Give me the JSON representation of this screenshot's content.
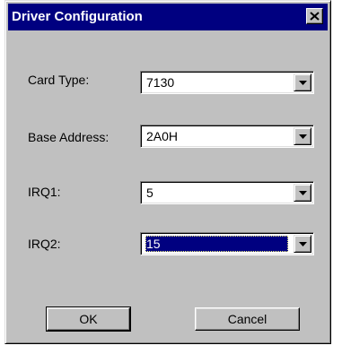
{
  "window": {
    "title": "Driver Configuration",
    "close_glyph": "✕"
  },
  "fields": {
    "card_type": {
      "label": "Card Type:",
      "value": "7130"
    },
    "base_address": {
      "label": "Base Address:",
      "value": "2A0H"
    },
    "irq1": {
      "label": "IRQ1:",
      "value": "5"
    },
    "irq2": {
      "label": "IRQ2:",
      "value": "15"
    }
  },
  "buttons": {
    "ok_label": "OK",
    "cancel_label": "Cancel"
  },
  "colors": {
    "titlebar": "#000080",
    "face": "#c0c0c0",
    "selection": "#000080"
  },
  "icons": {
    "close": "close-icon",
    "dropdown": "chevron-down-icon"
  }
}
